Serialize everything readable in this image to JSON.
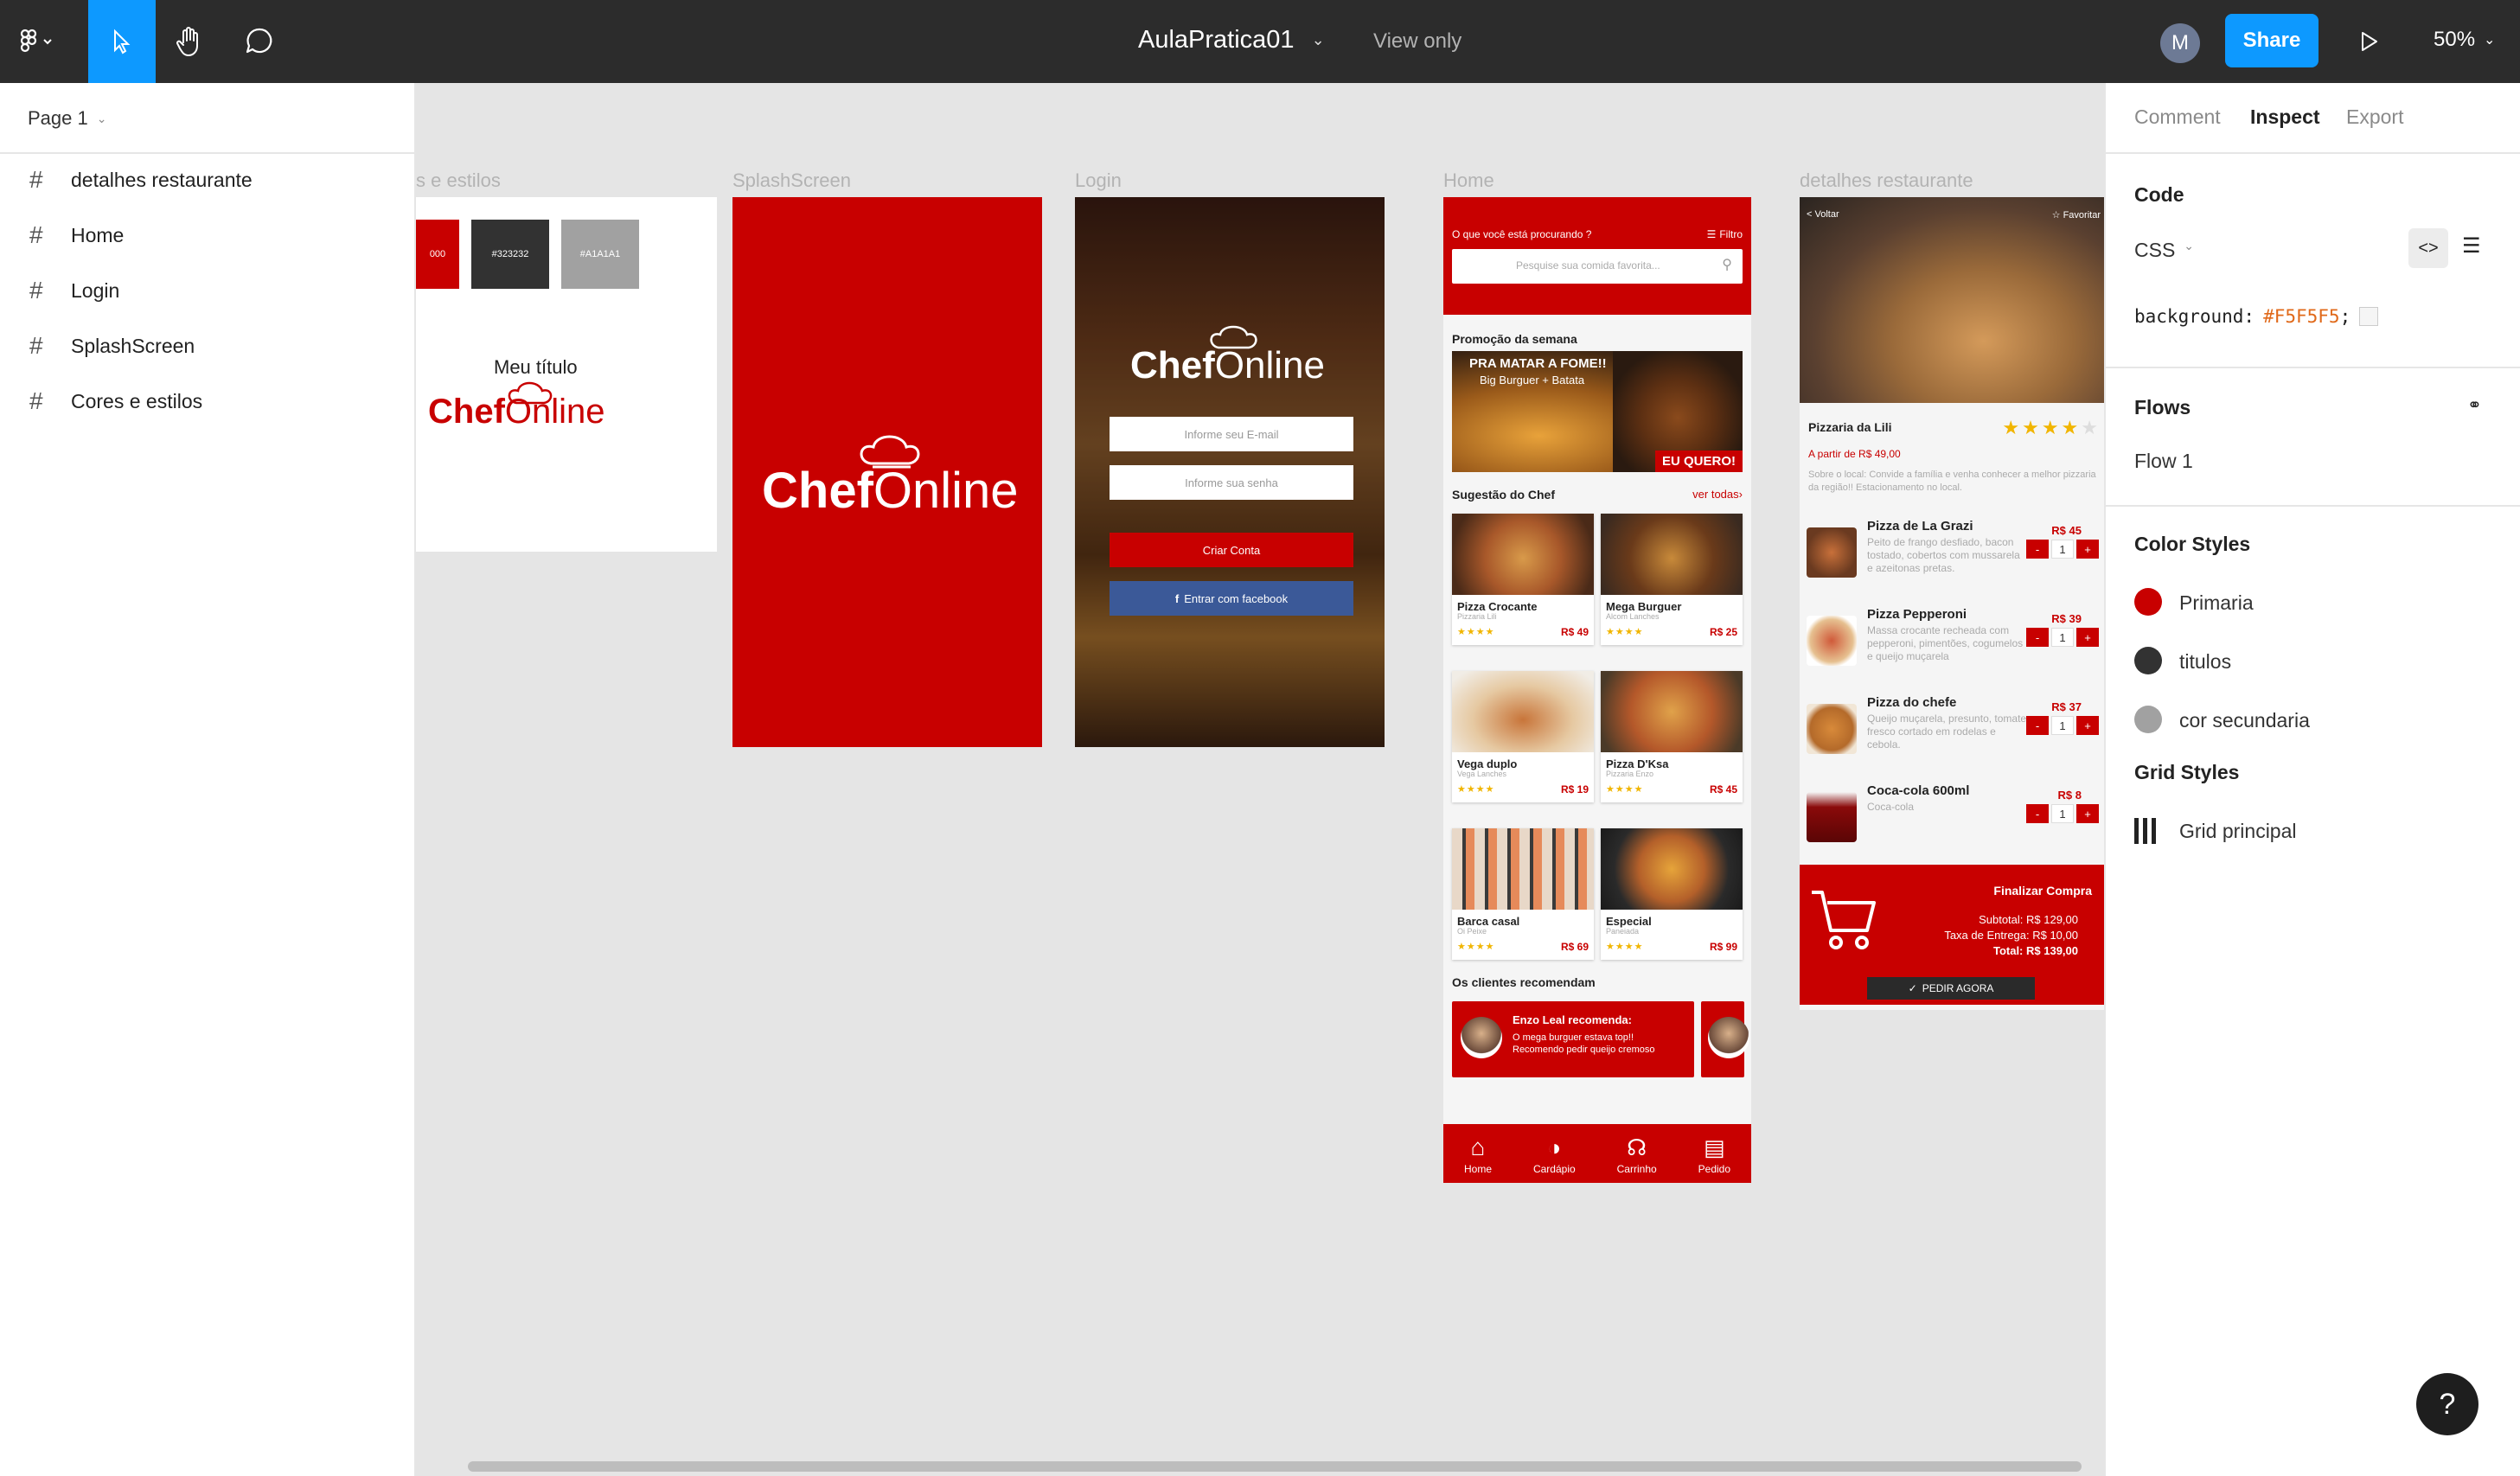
{
  "topbar": {
    "file_title": "AulaPratica01",
    "view_mode": "View only",
    "avatar_initial": "M",
    "share_label": "Share",
    "zoom": "50%"
  },
  "left_panel": {
    "page": "Page 1",
    "layers": [
      "detalhes restaurante",
      "Home",
      "Login",
      "SplashScreen",
      "Cores e estilos"
    ]
  },
  "right_panel": {
    "tabs": [
      "Comment",
      "Inspect",
      "Export"
    ],
    "active_tab": "Inspect",
    "code_heading": "Code",
    "code_lang": "CSS",
    "code_prop": "background:",
    "code_value": "#F5F5F5",
    "code_end": ";",
    "flows_heading": "Flows",
    "flow_item": "Flow 1",
    "color_styles_heading": "Color Styles",
    "color_styles": [
      {
        "name": "Primaria",
        "color": "#c80000"
      },
      {
        "name": "titulos",
        "color": "#323232"
      },
      {
        "name": "cor secundaria",
        "color": "#a1a1a1"
      }
    ],
    "grid_styles_heading": "Grid Styles",
    "grid_style": "Grid principal"
  },
  "canvas": {
    "frame_labels": {
      "cores": "s e estilos",
      "splash": "SplashScreen",
      "login": "Login",
      "home": "Home",
      "detalhes": "detalhes restaurante"
    },
    "cores": {
      "swatch1": "000",
      "swatch2": "#323232",
      "swatch3": "#A1A1A1",
      "title": "Meu título",
      "logo_a": "Chef",
      "logo_b": "Online"
    },
    "splash": {
      "logo_a": "Chef",
      "logo_b": "Online"
    },
    "login": {
      "logo_a": "Chef",
      "logo_b": "Online",
      "email_placeholder": "Informe seu E-mail",
      "password_placeholder": "Informe sua senha",
      "create_account": "Criar Conta",
      "facebook": "Entrar com facebook"
    },
    "home": {
      "header_question": "O que você está procurando ?",
      "filter": "Filtro",
      "search_placeholder": "Pesquise sua comida favorita...",
      "promo_heading": "Promoção da semana",
      "promo_line1": "PRA MATAR A FOME!!",
      "promo_line2": "Big Burguer + Batata",
      "promo_cta": "EU QUERO!",
      "chef_heading": "Sugestão do Chef",
      "see_all": "ver todas",
      "items": [
        {
          "name": "Pizza Crocante",
          "rest": "Pizzaria Lili",
          "stars": "★★★★",
          "price": "R$ 49"
        },
        {
          "name": "Mega Burguer",
          "rest": "Alcom Lanches",
          "stars": "★★★★",
          "price": "R$ 25"
        },
        {
          "name": "Vega duplo",
          "rest": "Vega Lanches",
          "stars": "★★★★",
          "price": "R$ 19"
        },
        {
          "name": "Pizza D'Ksa",
          "rest": "Pizzaria Enzo",
          "stars": "★★★★",
          "price": "R$ 45"
        },
        {
          "name": "Barca casal",
          "rest": "Oi Peixe",
          "stars": "★★★★",
          "price": "R$ 69"
        },
        {
          "name": "Especial",
          "rest": "Paneiada",
          "stars": "★★★★",
          "price": "R$ 99"
        }
      ],
      "reco_heading": "Os clientes recomendam",
      "reco_name": "Enzo Leal recomenda:",
      "reco_line1": "O mega burguer estava top!!",
      "reco_line2": "Recomendo pedir queijo cremoso",
      "nav": [
        "Home",
        "Cardápio",
        "Carrinho",
        "Pedido"
      ]
    },
    "detalhes": {
      "back": "< Voltar",
      "favorite": "☆ Favoritar",
      "restaurant": "Pizzaria da Lili",
      "stars": "★★★★",
      "stars_empty": "★",
      "from_price": "A partir de R$ 49,00",
      "about": "Sobre o local: Convide a família e venha conhecer a melhor pizzaria da região!! Estacionamento no local.",
      "items": [
        {
          "name": "Pizza de La Grazi",
          "desc": "Peito de frango desfiado, bacon tostado, cobertos com mussarela e azeitonas pretas.",
          "price": "R$ 45",
          "qty": "1"
        },
        {
          "name": "Pizza Pepperoni",
          "desc": "Massa crocante recheada com pepperoni, pimentões, cogumelos e queijo muçarela",
          "price": "R$ 39",
          "qty": "1"
        },
        {
          "name": "Pizza do chefe",
          "desc": "Queijo muçarela, presunto, tomate fresco cortado em rodelas e cebola.",
          "price": "R$ 37",
          "qty": "1"
        },
        {
          "name": "Coca-cola 600ml",
          "desc": "Coca-cola",
          "price": "R$ 8",
          "qty": "1"
        }
      ],
      "checkout_title": "Finalizar Compra",
      "subtotal": "Subtotal: R$ 129,00",
      "delivery": "Taxa de Entrega: R$ 10,00",
      "total": "Total: R$ 139,00",
      "order_now": "PEDIR AGORA"
    }
  }
}
